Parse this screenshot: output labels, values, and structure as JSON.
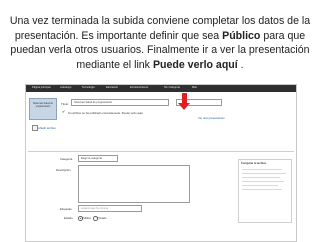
{
  "caption": {
    "part1": "Una vez terminada la subida conviene completar los datos de la presentación. Es importante definir que sea ",
    "bold1": "Público",
    "part2": " para que puedan verla otros usuarios. Finalmente ir a ver la presentación mediante el link ",
    "bold2": "Puede verlo aquí",
    "part3": " ."
  },
  "nav": {
    "items": [
      "Página principal",
      "Liderazgo",
      "Tecnología",
      "Educación",
      "Entretenimiento",
      "Sin Categoría",
      "Más"
    ]
  },
  "thumbnail": {
    "text": "Sistemas Salud de programación"
  },
  "form": {
    "title_label": "Título:",
    "title_value": "Sistemas Salud de programación",
    "status_text": "Su archivo se ha publicado correctamente. Puede verlo aquí",
    "link_right": "Ver otra presentación",
    "category_label": "Categoría",
    "category_value": "Elegir la categoría",
    "description_label": "Descripción",
    "tags_label": "Etiquetas",
    "tags_placeholder": "separar tags by comma",
    "privacy_label": "Estado",
    "privacy_public": "Público",
    "privacy_private": "Privado",
    "upload_action": "Añadir archivo",
    "sidepanel_title": "Comparte tu archivo"
  },
  "colors": {
    "arrow": "#e02020",
    "nav_bg": "#2f2f2f"
  }
}
